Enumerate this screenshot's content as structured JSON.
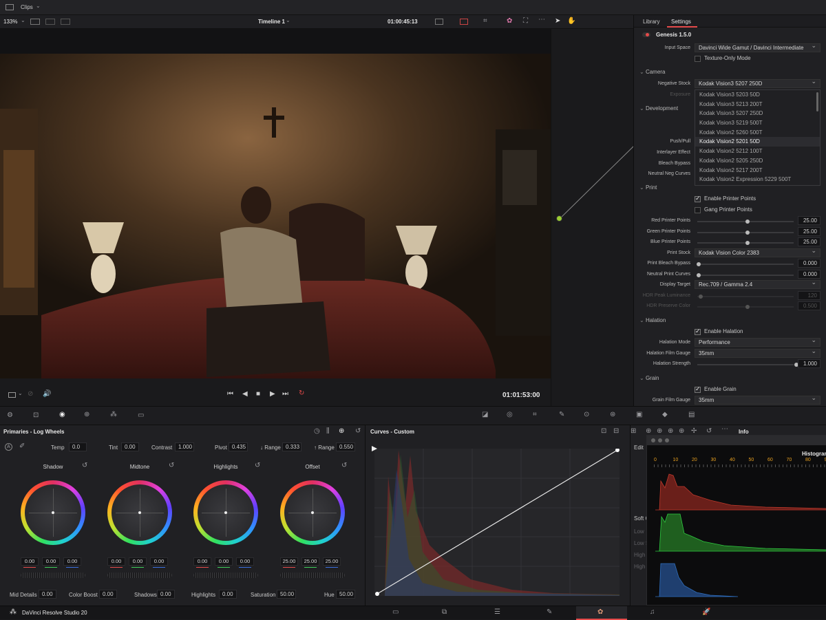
{
  "topbar": {
    "clips_label": "Clips"
  },
  "viewerbar": {
    "zoom": "133%",
    "timeline_name": "Timeline 1",
    "timecode": "01:00:45:13"
  },
  "transport": {
    "timecode": "01:01:53:00"
  },
  "panel": {
    "tabs": [
      "Library",
      "Settings"
    ],
    "active_tab": "Settings",
    "plugin_name": "Genesis 1.5.0",
    "input_space_label": "Input Space",
    "input_space_value": "Davinci Wide Gamut / Davinci Intermediate",
    "texture_only_label": "Texture-Only Mode",
    "camera_section": "Camera",
    "negative_stock_label": "Negative Stock",
    "negative_stock_value": "Kodak Vision3 5207 250D",
    "exposure_label": "Exposure",
    "stock_options": [
      "Kodak Vision3 5203 50D",
      "Kodak Vision3 5213 200T",
      "Kodak Vision3 5207 250D",
      "Kodak Vision3 5219 500T",
      "Kodak Vision2 5260 500T",
      "Kodak Vision2 5201 50D",
      "Kodak Vision2 5212 100T",
      "Kodak Vision2 5205 250D",
      "Kodak Vision2 5217 200T",
      "Kodak Vision2 Expression 5229 500T"
    ],
    "stock_highlighted": "Kodak Vision2 5201 50D",
    "development_section": "Development",
    "push_pull_label": "Push/Pull",
    "interlayer_label": "Interlayer Effect",
    "bleach_bypass_label": "Bleach Bypass",
    "neutral_neg_label": "Neutral Neg Curves",
    "print_section": "Print",
    "enable_printer_points": "Enable Printer Points",
    "gang_printer_points": "Gang Printer Points",
    "red_points_label": "Red Printer Points",
    "red_points_value": "25.00",
    "green_points_label": "Green Printer Points",
    "green_points_value": "25.00",
    "blue_points_label": "Blue Printer Points",
    "blue_points_value": "25.00",
    "print_stock_label": "Print Stock",
    "print_stock_value": "Kodak Vision Color 2383",
    "print_bleach_label": "Print Bleach Bypass",
    "print_bleach_value": "0.000",
    "neutral_print_label": "Neutral Print Curves",
    "neutral_print_value": "0.000",
    "display_target_label": "Display Target",
    "display_target_value": "Rec.709 / Gamma 2.4",
    "hdr_peak_label": "HDR Peak Luminance",
    "hdr_peak_value": "120",
    "hdr_preserve_label": "HDR Preserve Color",
    "hdr_preserve_value": "0.500",
    "halation_section": "Halation",
    "enable_halation": "Enable Halation",
    "halation_mode_label": "Halation Mode",
    "halation_mode_value": "Performance",
    "halation_gauge_label": "Halation Film Gauge",
    "halation_gauge_value": "35mm",
    "halation_strength_label": "Halation Strength",
    "halation_strength_value": "1.000",
    "grain_section": "Grain",
    "enable_grain": "Enable Grain",
    "grain_gauge_label": "Grain Film Gauge",
    "grain_gauge_value": "35mm"
  },
  "primaries": {
    "title": "Primaries - Log Wheels",
    "temp_label": "Temp",
    "temp_value": "0.0",
    "tint_label": "Tint",
    "tint_value": "0.00",
    "contrast_label": "Contrast",
    "contrast_value": "1.000",
    "pivot_label": "Pivot",
    "pivot_value": "0.435",
    "low_range_label": "↓ Range",
    "low_range_value": "0.333",
    "high_range_label": "↑ Range",
    "high_range_value": "0.550",
    "wheels": [
      {
        "name": "Shadow",
        "values": [
          "0.00",
          "0.00",
          "0.00"
        ]
      },
      {
        "name": "Midtone",
        "values": [
          "0.00",
          "0.00",
          "0.00"
        ]
      },
      {
        "name": "Highlights",
        "values": [
          "0.00",
          "0.00",
          "0.00"
        ]
      },
      {
        "name": "Offset",
        "values": [
          "25.00",
          "25.00",
          "25.00"
        ]
      }
    ],
    "mid_details_label": "Mid Details",
    "mid_details_value": "0.00",
    "color_boost_label": "Color Boost",
    "color_boost_value": "0.00",
    "shadows_label": "Shadows",
    "shadows_value": "0.00",
    "highlights_label": "Highlights",
    "highlights_value": "0.00",
    "saturation_label": "Saturation",
    "saturation_value": "50.00",
    "hue_label": "Hue",
    "hue_value": "50.00"
  },
  "curves": {
    "title": "Curves - Custom",
    "edit_label": "Edit",
    "soft_label": "Soft C",
    "low_label": "Low",
    "low2_label": "Low S",
    "high_label": "High",
    "high2_label": "High"
  },
  "info": {
    "title": "Info",
    "histogram_title": "Histogram",
    "scale_ticks": [
      "0",
      "10",
      "20",
      "30",
      "40",
      "50",
      "60",
      "70",
      "80",
      "9"
    ]
  },
  "bottombar": {
    "app_name": "DaVinci Resolve Studio 20"
  },
  "colors": {
    "accent": "#e64a4a",
    "wheel_ring": "#1a1a1c",
    "histogram_red": "#c0392b",
    "histogram_green": "#2ecc40",
    "histogram_blue": "#2f6fbf"
  }
}
